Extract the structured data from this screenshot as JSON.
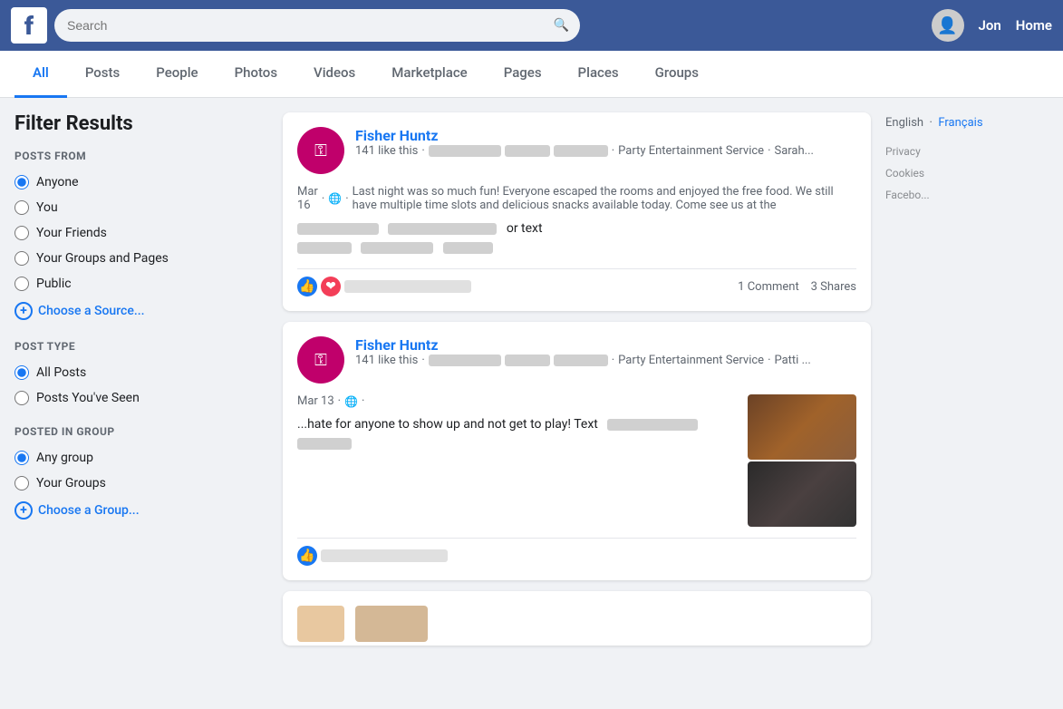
{
  "header": {
    "logo": "f",
    "search_placeholder": "Search",
    "user_name": "Jon",
    "home_label": "Home"
  },
  "nav": {
    "tabs": [
      {
        "id": "all",
        "label": "All",
        "active": true
      },
      {
        "id": "posts",
        "label": "Posts",
        "active": false
      },
      {
        "id": "people",
        "label": "People",
        "active": false
      },
      {
        "id": "photos",
        "label": "Photos",
        "active": false
      },
      {
        "id": "videos",
        "label": "Videos",
        "active": false
      },
      {
        "id": "marketplace",
        "label": "Marketplace",
        "active": false
      },
      {
        "id": "pages",
        "label": "Pages",
        "active": false
      },
      {
        "id": "places",
        "label": "Places",
        "active": false
      },
      {
        "id": "groups",
        "label": "Groups",
        "active": false
      }
    ]
  },
  "filter": {
    "title": "Filter Results",
    "posts_from": {
      "section_title": "POSTS FROM",
      "options": [
        {
          "id": "anyone",
          "label": "Anyone",
          "checked": true
        },
        {
          "id": "you",
          "label": "You",
          "checked": false
        },
        {
          "id": "your-friends",
          "label": "Your Friends",
          "checked": false
        },
        {
          "id": "your-groups-pages",
          "label": "Your Groups and Pages",
          "checked": false
        },
        {
          "id": "public",
          "label": "Public",
          "checked": false
        }
      ],
      "choose_source": "Choose a Source..."
    },
    "post_type": {
      "section_title": "POST TYPE",
      "options": [
        {
          "id": "all-posts",
          "label": "All Posts",
          "checked": true
        },
        {
          "id": "posts-youve-seen",
          "label": "Posts You've Seen",
          "checked": false
        }
      ]
    },
    "posted_in_group": {
      "section_title": "POSTED IN GROUP",
      "options": [
        {
          "id": "any-group",
          "label": "Any group",
          "checked": true
        },
        {
          "id": "your-groups",
          "label": "Your Groups",
          "checked": false
        }
      ],
      "choose_group": "Choose a Group..."
    }
  },
  "posts": [
    {
      "id": "post1",
      "author": "Fisher Huntz",
      "likes": "141 like this",
      "service": "Party Entertainment Service",
      "tagged": "Sarah...",
      "date": "Mar 16",
      "text": "Last night was so much fun! Everyone escaped the rooms and enjoyed the free food. We still have multiple time slots and delicious snacks available today. Come see us at the",
      "text_suffix": "or text",
      "comments": "1 Comment",
      "shares": "3 Shares",
      "has_image": false
    },
    {
      "id": "post2",
      "author": "Fisher Huntz",
      "likes": "141 like this",
      "service": "Party Entertainment Service",
      "tagged": "Patti ...",
      "date": "Mar 13",
      "text": "...hate for anyone to show up and not get to play! Text",
      "has_image": true
    }
  ],
  "right_sidebar": {
    "language_current": "English",
    "language_link": "Français",
    "footer_items": [
      "Privacy",
      "Cookies",
      "Facebo..."
    ]
  }
}
